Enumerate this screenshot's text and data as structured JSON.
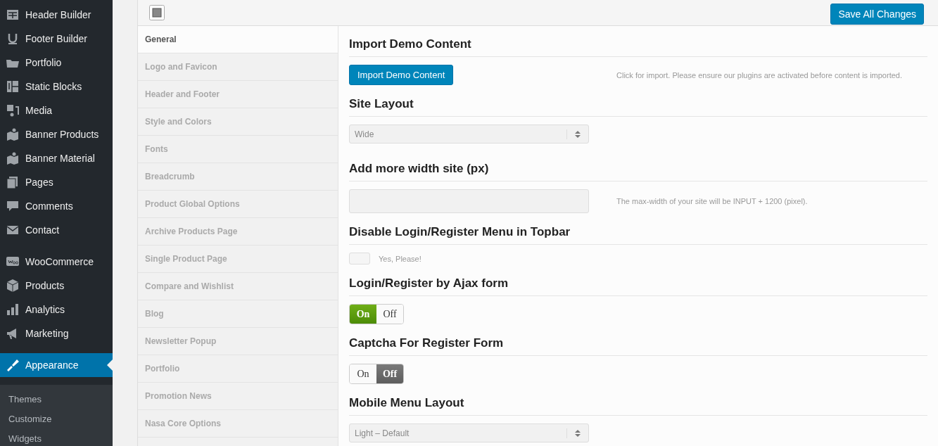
{
  "sidebar": {
    "groups": [
      [
        {
          "label": "Header Builder",
          "selected": false
        },
        {
          "label": "Footer Builder",
          "selected": false
        },
        {
          "label": "Portfolio",
          "selected": false
        },
        {
          "label": "Static Blocks",
          "selected": false
        },
        {
          "label": "Media",
          "selected": false
        },
        {
          "label": "Banner Products",
          "selected": false
        },
        {
          "label": "Banner Material",
          "selected": false
        },
        {
          "label": "Pages",
          "selected": false
        },
        {
          "label": "Comments",
          "selected": false
        },
        {
          "label": "Contact",
          "selected": false
        }
      ],
      [
        {
          "label": "WooCommerce",
          "selected": false
        },
        {
          "label": "Products",
          "selected": false
        },
        {
          "label": "Analytics",
          "selected": false
        },
        {
          "label": "Marketing",
          "selected": false
        }
      ],
      [
        {
          "label": "Appearance",
          "selected": true
        }
      ]
    ],
    "submenu": [
      {
        "label": "Themes",
        "selected": false
      },
      {
        "label": "Customize",
        "selected": false
      },
      {
        "label": "Widgets",
        "selected": false
      }
    ]
  },
  "toolbar": {
    "save_button": "Save All Changes"
  },
  "tabs": [
    {
      "label": "General",
      "selected": true
    },
    {
      "label": "Logo and Favicon",
      "selected": false
    },
    {
      "label": "Header and Footer",
      "selected": false
    },
    {
      "label": "Style and Colors",
      "selected": false
    },
    {
      "label": "Fonts",
      "selected": false
    },
    {
      "label": "Breadcrumb",
      "selected": false
    },
    {
      "label": "Product Global Options",
      "selected": false
    },
    {
      "label": "Archive Products Page",
      "selected": false
    },
    {
      "label": "Single Product Page",
      "selected": false
    },
    {
      "label": "Compare and Wishlist",
      "selected": false
    },
    {
      "label": "Blog",
      "selected": false
    },
    {
      "label": "Newsletter Popup",
      "selected": false
    },
    {
      "label": "Portfolio",
      "selected": false
    },
    {
      "label": "Promotion News",
      "selected": false
    },
    {
      "label": "Nasa Core Options",
      "selected": false
    }
  ],
  "sections": [
    {
      "title": "Import Demo Content",
      "kind": "button",
      "button": "Import Demo Content",
      "description": "Click for import. Please ensure our plugins are activated before content is imported."
    },
    {
      "title": "Site Layout",
      "kind": "select",
      "value": "Wide"
    },
    {
      "title": "Add more width site (px)",
      "kind": "text",
      "description": "The max-width of your site will be INPUT + 1200 (pixel)."
    },
    {
      "title": "Disable Login/Register Menu in Topbar",
      "kind": "checkbox",
      "checked": false,
      "label": "Yes, Please!"
    },
    {
      "title": "Login/Register by Ajax form",
      "kind": "switch",
      "on": true,
      "on_label": "On",
      "off_label": "Off"
    },
    {
      "title": "Captcha For Register Form",
      "kind": "switch",
      "on": false,
      "on_label": "On",
      "off_label": "Off"
    },
    {
      "title": "Mobile Menu Layout",
      "kind": "select",
      "value": "Light – Default"
    }
  ]
}
